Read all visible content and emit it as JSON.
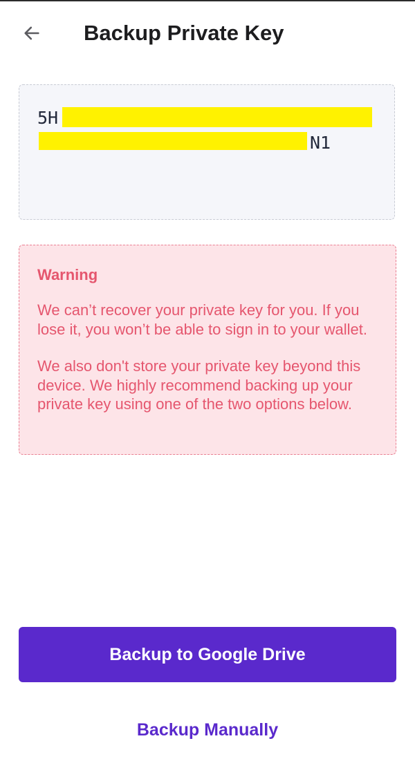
{
  "header": {
    "title": "Backup Private Key",
    "back_icon": "arrow-left-icon"
  },
  "private_key": {
    "line1_start": "5H",
    "line2_end": "N1",
    "redaction_color": "#fff200"
  },
  "warning": {
    "title": "Warning",
    "paragraph1": "We can’t recover your private key for you. If you lose it, you won’t be able to sign in to your wallet.",
    "paragraph2": "We also don't store your private key beyond this device. We highly recommend backing up your private key using one of the two options below."
  },
  "actions": {
    "google_drive_label": "Backup to Google Drive",
    "manual_label": "Backup Manually"
  },
  "colors": {
    "accent": "#5a29cc",
    "warning_text": "#e5566e",
    "warning_bg": "#fde4e8",
    "key_box_bg": "#f5f6fa"
  }
}
